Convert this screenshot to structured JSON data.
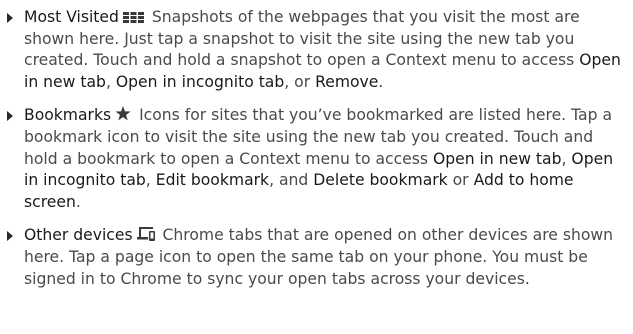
{
  "items": [
    {
      "term": "Most Visited",
      "icon": "grid-icon",
      "parts": [
        " Snapshots of the webpages that you visit the most are shown here. Just tap a snapshot to visit the site using the new tab you created. Touch and hold a snapshot to open a Context menu to access ",
        "Open in new tab",
        ", ",
        "Open in incognito tab",
        ", or ",
        "Remove",
        "."
      ]
    },
    {
      "term": "Bookmarks",
      "icon": "star-icon",
      "parts": [
        " Icons for sites that you’ve bookmarked are listed here. Tap a bookmark icon to visit the site using the new tab you created. Touch and hold a bookmark to open a Context menu to access ",
        "Open in new tab",
        ", ",
        "Open in incognito tab",
        ", ",
        "Edit bookmark",
        ", and ",
        "Delete bookmark",
        " or ",
        "Add to home screen",
        "."
      ]
    },
    {
      "term": "Other devices",
      "icon": "devices-icon",
      "parts": [
        " Chrome tabs that are opened on other devices are shown here. Tap a page icon to open the same tab on your phone. You must be signed in to Chrome to sync your open tabs across your devices."
      ]
    }
  ]
}
